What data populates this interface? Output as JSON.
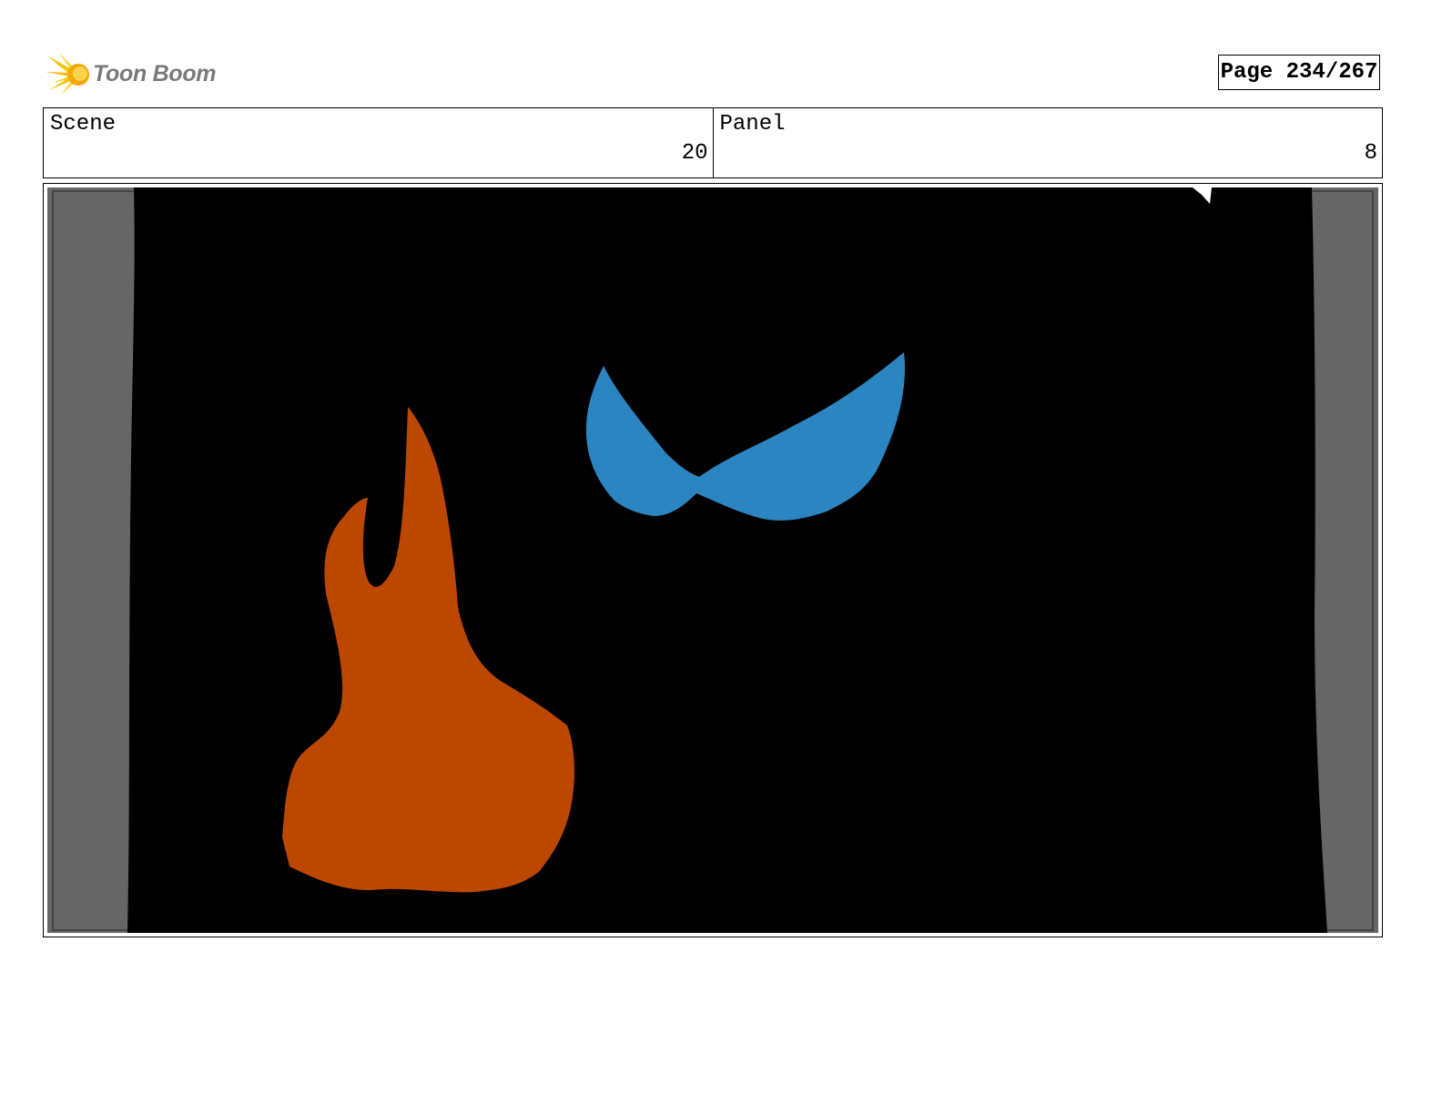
{
  "header": {
    "logo_text": "Toon Boom",
    "logo_icon": "starburst-icon",
    "page_indicator": "Page 234/267"
  },
  "info": {
    "scene_label": "Scene",
    "scene_value": "20",
    "panel_label": "Panel",
    "panel_value": "8"
  },
  "drawing": {
    "background": "#000000",
    "side_margin_color": "#666666",
    "flame_color": "#bc4700",
    "eyes_color": "#2a85c0"
  }
}
